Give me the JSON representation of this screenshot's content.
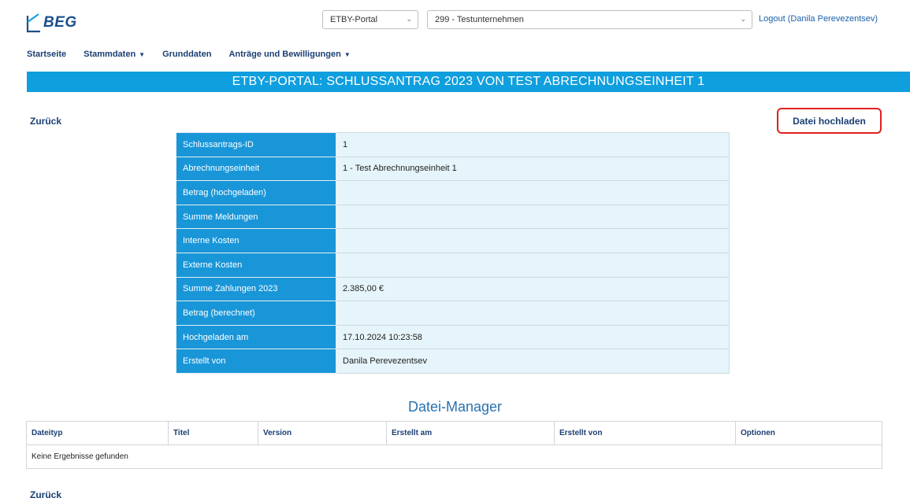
{
  "header": {
    "logo_text": "BEG",
    "portal_select": "ETBY-Portal",
    "company_select": "299 - Testunternehmen",
    "logout": "Logout (Danila Perevezentsev)"
  },
  "nav": {
    "items": [
      {
        "label": "Startseite",
        "dropdown": false
      },
      {
        "label": "Stammdaten",
        "dropdown": true
      },
      {
        "label": "Grunddaten",
        "dropdown": false
      },
      {
        "label": "Anträge und Bewilligungen",
        "dropdown": true
      }
    ]
  },
  "page": {
    "title": "ETBY-PORTAL: SCHLUSSANTRAG 2023 VON TEST ABRECHNUNGSEINHEIT 1",
    "back_label": "Zurück",
    "upload_label": "Datei hochladen"
  },
  "details": [
    {
      "key": "Schlussantrags-ID",
      "value": "1"
    },
    {
      "key": "Abrechnungseinheit",
      "value": "1 - Test Abrechnungseinheit 1"
    },
    {
      "key": "Betrag (hochgeladen)",
      "value": ""
    },
    {
      "key": "Summe Meldungen",
      "value": ""
    },
    {
      "key": "Interne Kosten",
      "value": ""
    },
    {
      "key": "Externe Kosten",
      "value": ""
    },
    {
      "key": "Summe Zahlungen 2023",
      "value": "2.385,00 €"
    },
    {
      "key": "Betrag (berechnet)",
      "value": ""
    },
    {
      "key": "Hochgeladen am",
      "value": "17.10.2024 10:23:58"
    },
    {
      "key": "Erstellt von",
      "value": "Danila Perevezentsev"
    }
  ],
  "file_manager": {
    "title": "Datei-Manager",
    "columns": [
      "Dateityp",
      "Titel",
      "Version",
      "Erstellt am",
      "Erstellt von",
      "Optionen"
    ],
    "empty_text": "Keine Ergebnisse gefunden"
  },
  "colors": {
    "accent": "#0f9fde",
    "label_cell": "#1996d8",
    "value_cell": "#e6f5fb",
    "link": "#1b3f73",
    "highlight_border": "#e0201e"
  }
}
